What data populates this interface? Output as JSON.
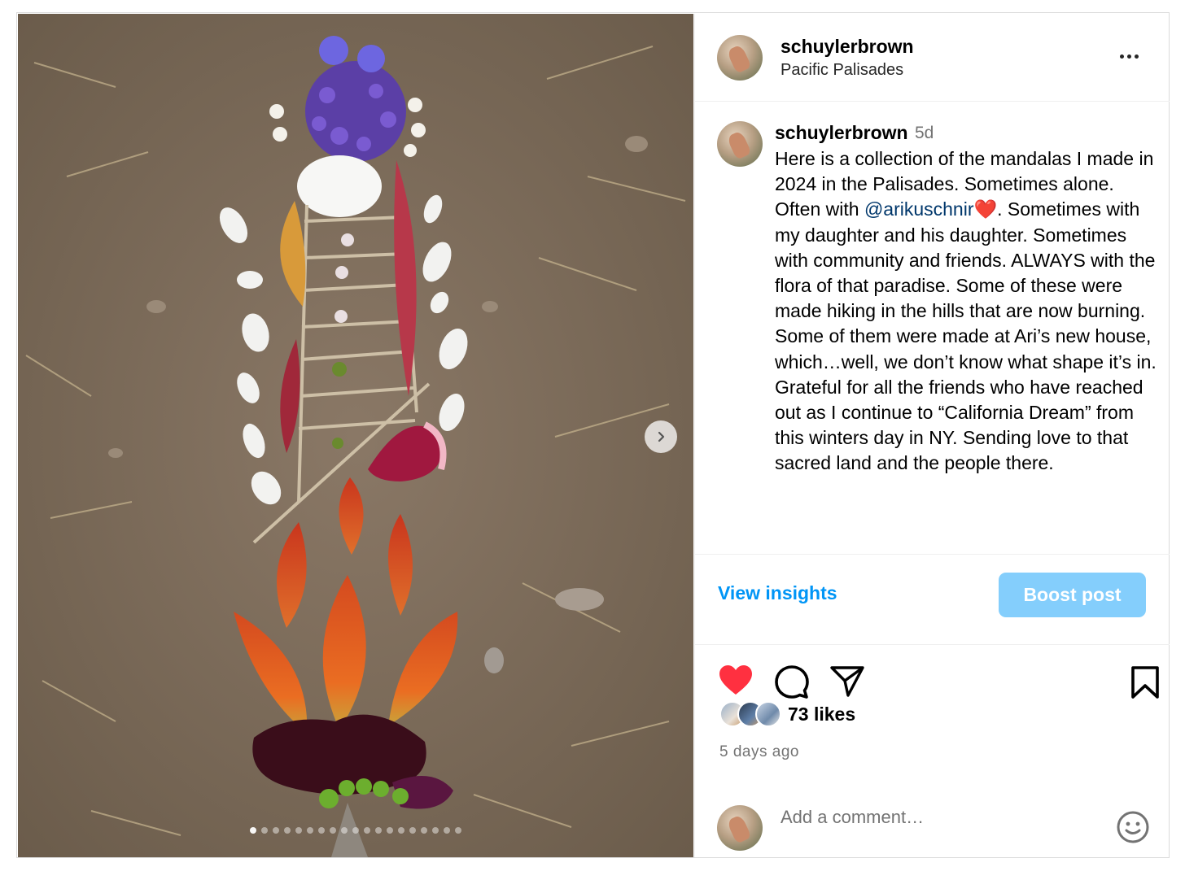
{
  "post": {
    "username": "schuylerbrown",
    "location": "Pacific Palisades",
    "caption_username": "schuylerbrown",
    "caption_time": "5d",
    "caption_before_mention": "Here is a collection of the mandalas I made in 2024 in the Palisades. Sometimes alone. Often with ",
    "mention": "@arikuschnir",
    "heart_emoji": "❤️",
    "caption_after_mention": ". Sometimes with my daughter and his daughter. Sometimes with community and friends. ALWAYS with the flora of that paradise. Some of these were made hiking in the hills that are now burning. Some of them were made at Ari’s new house, which…well, we don’t know what shape it’s in. Grateful for all the friends who have reached out as I continue to “California Dream” from this winters day in NY. Sending love to that sacred land and the people there.",
    "view_insights_label": "View insights",
    "boost_label": "Boost post",
    "likes": "73 likes",
    "time_ago": "5 days ago",
    "comment_placeholder": "Add a comment…",
    "carousel_count": 19,
    "carousel_active_index": 0,
    "liked": true
  },
  "colors": {
    "link_blue": "#0095f6",
    "boost_bg": "#84cefc",
    "like_red": "#ff3040",
    "mention": "#00376b"
  },
  "icons": {
    "like": "heart-filled-icon",
    "comment": "comment-bubble-icon",
    "share": "paper-plane-icon",
    "save": "bookmark-icon",
    "emoji": "smiley-icon",
    "more": "more-options-icon",
    "next": "chevron-right-icon"
  }
}
